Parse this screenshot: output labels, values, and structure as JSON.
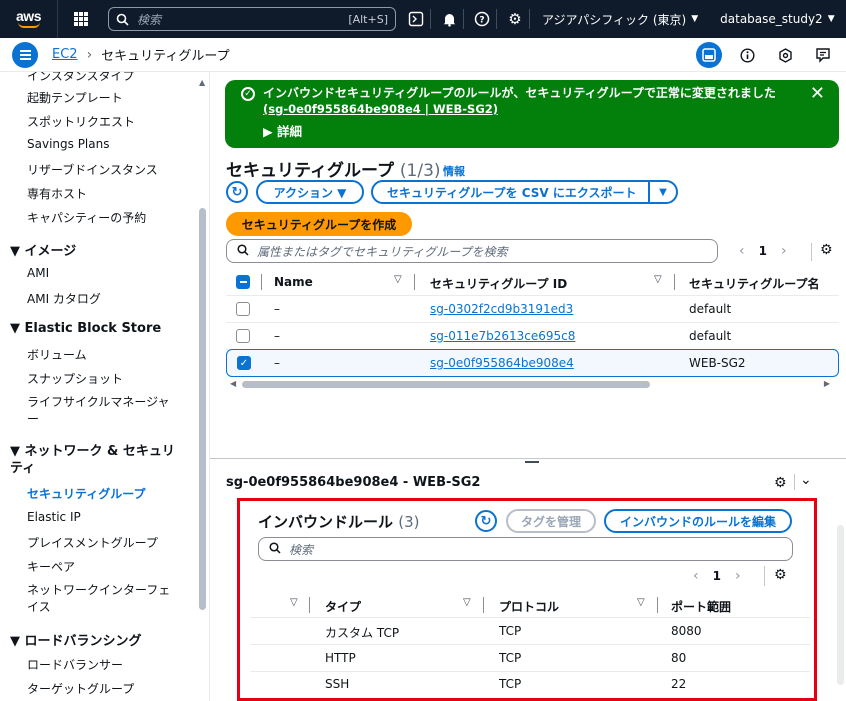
{
  "topnav": {
    "logo_text": "aws",
    "search_placeholder": "検索",
    "search_shortcut": "[Alt+S]",
    "region": "アジアパシフィック (東京)",
    "account": "database_study2"
  },
  "breadcrumb": {
    "service": "EC2",
    "current": "セキュリティグループ"
  },
  "sidebar": {
    "partial_item": "インスタンスタイプ",
    "items_instances": [
      "起動テンプレート",
      "スポットリクエスト",
      "Savings Plans",
      "リザーブドインスタンス",
      "専有ホスト",
      "キャパシティーの予約"
    ],
    "section_images": "▼ イメージ",
    "items_images": [
      "AMI",
      "AMI カタログ"
    ],
    "section_ebs": "▼ Elastic Block Store",
    "items_ebs": [
      "ボリューム",
      "スナップショット",
      "ライフサイクルマネージャー"
    ],
    "section_network": "▼ ネットワーク & セキュリティ",
    "items_network": [
      "セキュリティグループ",
      "Elastic IP",
      "プレイスメントグループ",
      "キーペア",
      "ネットワークインターフェイス"
    ],
    "section_lb": "▼ ロードバランシング",
    "items_lb": [
      "ロードバランサー",
      "ターゲットグループ"
    ]
  },
  "flash": {
    "message": "インバウンドセキュリティグループのルールが、セキュリティグループで正常に変更されました",
    "link": "(sg-0e0f955864be908e4 | WEB-SG2)",
    "details": "▶ 詳細"
  },
  "sg_list": {
    "title": "セキュリティグループ",
    "count": "(1/3)",
    "info": "情報",
    "actions_label": "アクション ▼",
    "export_label": "セキュリティグループを CSV にエクスポート",
    "create_label": "セキュリティグループを作成",
    "filter_placeholder": "属性またはタグでセキュリティグループを検索",
    "page": "1",
    "columns": [
      "Name",
      "セキュリティグループ ID",
      "セキュリティグループ名"
    ],
    "rows": [
      {
        "name": "–",
        "id": "sg-0302f2cd9b3191ed3",
        "group_name": "default",
        "selected": false
      },
      {
        "name": "–",
        "id": "sg-011e7b2613ce695c8",
        "group_name": "default",
        "selected": false
      },
      {
        "name": "–",
        "id": "sg-0e0f955864be908e4",
        "group_name": "WEB-SG2",
        "selected": true
      }
    ]
  },
  "detail": {
    "title": "sg-0e0f955864be908e4 - WEB-SG2",
    "inbound_title": "インバウンドルール",
    "inbound_count": "(3)",
    "manage_tags_label": "タグを管理",
    "edit_rules_label": "インバウンドのルールを編集",
    "filter_placeholder": "検索",
    "page": "1",
    "columns": [
      "タイプ",
      "プロトコル",
      "ポート範囲"
    ],
    "rows": [
      {
        "type": "カスタム TCP",
        "protocol": "TCP",
        "port": "8080"
      },
      {
        "type": "HTTP",
        "protocol": "TCP",
        "port": "80"
      },
      {
        "type": "SSH",
        "protocol": "TCP",
        "port": "22"
      }
    ]
  },
  "colors": {
    "nav_bg": "#0f1b2a",
    "link": "#0972d3",
    "success": "#037f0c",
    "primary_button": "#ff9900",
    "highlight_box": "#e60012"
  }
}
